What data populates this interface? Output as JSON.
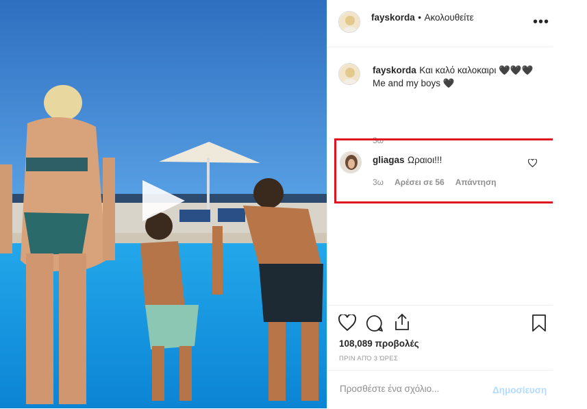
{
  "header": {
    "username": "fayskorda",
    "separator": "•",
    "follow_label": "Ακολουθείτε",
    "more_label": "•••"
  },
  "caption": {
    "username": "fayskorda",
    "line1": "Και καλό καλοκαιρι 🖤🖤🖤",
    "line2": "Me and my boys 🖤"
  },
  "comment": {
    "prev_time": "3ω",
    "username": "gliagas",
    "text": "Ωραιοι!!!",
    "time": "3ω",
    "likes": "Αρέσει σε 56",
    "reply": "Απάντηση"
  },
  "stats": {
    "views": "108,089 προβολές",
    "posted": "ΠΡΙΝ ΑΠΌ 3 ΏΡΕΣ"
  },
  "add_comment": {
    "placeholder": "Προσθέστε ένα σχόλιο...",
    "post_label": "Δημοσίευση"
  },
  "colors": {
    "highlight": "#e0141e",
    "post_disabled": "#b3dbff",
    "sky": "#3a7fc8",
    "pool": "#1e9be3"
  }
}
